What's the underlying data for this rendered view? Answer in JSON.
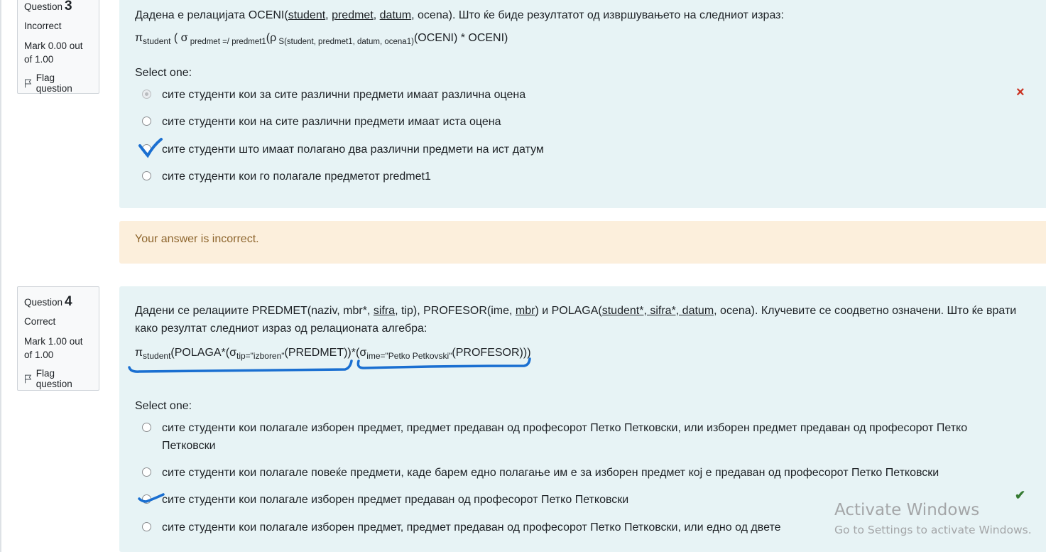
{
  "q3": {
    "question_label": "Question",
    "question_number": "3",
    "state": "Incorrect",
    "mark": "Mark 0.00 out of 1.00",
    "flag_label": "Flag question",
    "text_prefix": "Дадена е релацијата OCENI(",
    "keys": [
      "student",
      "predmet",
      "datum"
    ],
    "text_suffix": ", ocena). Што ќе биде резултатот од извршувањето на следниот израз:",
    "formula": {
      "pi": "π",
      "pi_sub": "student",
      "open": " ( σ",
      "sigma_sub": " predmet =/ predmet1",
      "rho": "(ρ",
      "rho_sub": " S(student, predmet1, datum, ocena1)",
      "rest": "(OCENI) * OCENI)"
    },
    "select_label": "Select one:",
    "answers": [
      "сите студенти кои за сите различни предмети имаат различна оцена",
      "сите студенти кои на сите различни предмети имаат иста оцена",
      "сите студенти што имаат полагано два различни предмети на ист датум",
      "сите студенти кои го полагале предметот predmet1"
    ],
    "selected_index": 0,
    "result_icon": "×",
    "feedback": "Your answer is incorrect."
  },
  "q4": {
    "question_label": "Question",
    "question_number": "4",
    "state": "Correct",
    "mark": "Mark 1.00 out of 1.00",
    "flag_label": "Flag question",
    "text_a": "Дадени се релациите PREDMET(naziv, mbr*, ",
    "key_sifra": "sifra",
    "text_b": ", tip), PROFESOR(ime, ",
    "key_mbr": "mbr",
    "text_c": ") и POLAGA(",
    "key_polaga": "student*, sifra*, datum",
    "text_d": ", ocena). Клучевите се соодветно означени. Што ќе врати како резултат следниот израз од релационата алгебра:",
    "formula": {
      "pi": "π",
      "pi_sub": "student",
      "part1": "(POLAGA*(σ",
      "sub1": "tip=\"izboren\"",
      "part2": "(PREDMET))*(σ",
      "sub2": "ime=\"Petko Petkovski\"",
      "part3": "(PROFESOR)))"
    },
    "select_label": "Select one:",
    "answers": [
      "сите студенти кои полагале изборен предмет, предмет предаван од професорот Петко Петковски, или изборен предмет предаван од професорот Петко Петковски",
      "сите студенти кои полагале повеќе предмети, каде барем едно полагање им е за изборен предмет кој е предаван од професорот Петко Петковски",
      "сите студенти кои полагале изборен предмет предаван од професорот Петко Петковски",
      "сите студенти кои полагале изборен предмет, предмет предаван од професорот Петко Петковски, или едно од двете"
    ],
    "result_icon": "✔"
  },
  "watermark": {
    "line1": "Activate Windows",
    "line2": "Go to Settings to activate Windows."
  },
  "colors": {
    "incorrect": "#ca3120",
    "correct": "#357a32",
    "ink": "#1a6fd1"
  }
}
